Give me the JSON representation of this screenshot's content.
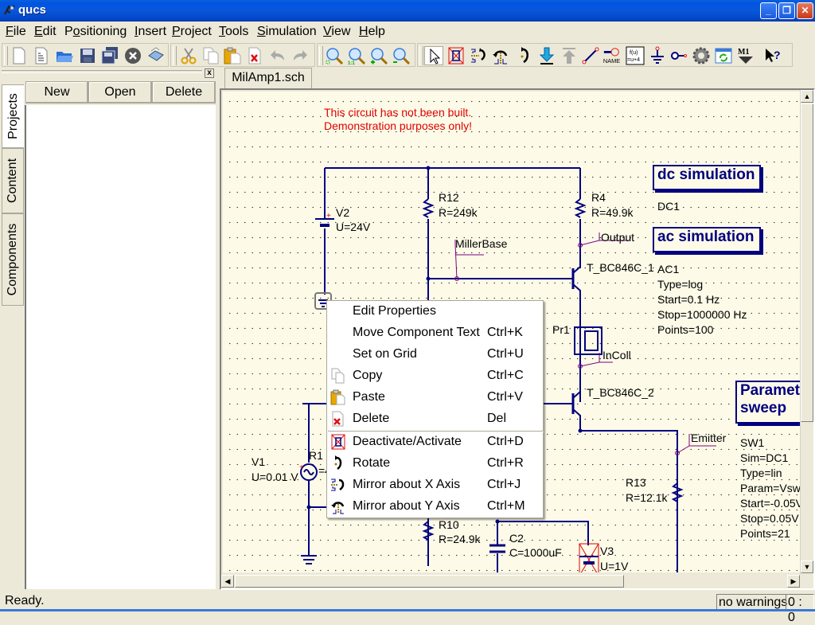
{
  "window": {
    "title": "qucs",
    "minimize": "_",
    "restore": "❐",
    "close": "✕"
  },
  "menubar": [
    {
      "label": "File",
      "accel": "F",
      "rest": "ile"
    },
    {
      "label": "Edit",
      "accel": "E",
      "rest": "dit"
    },
    {
      "label": "Positioning",
      "pre": "P",
      "accel": "o",
      "rest": "sitioning"
    },
    {
      "label": "Insert",
      "accel": "I",
      "rest": "nsert"
    },
    {
      "label": "Project",
      "accel": "P",
      "rest": "roject"
    },
    {
      "label": "Tools",
      "accel": "T",
      "rest": "ools"
    },
    {
      "label": "Simulation",
      "accel": "S",
      "rest": "imulation"
    },
    {
      "label": "View",
      "accel": "V",
      "rest": "iew"
    },
    {
      "label": "Help",
      "accel": "H",
      "rest": "elp"
    }
  ],
  "toolbar": {
    "file_icons": [
      "new-document",
      "new-text",
      "open-folder",
      "save",
      "save-all",
      "close-document",
      "print"
    ],
    "edit_icons": [
      "cut",
      "copy",
      "paste",
      "delete",
      "undo",
      "redo"
    ],
    "view_icons": [
      "zoom-fit",
      "zoom-1to1",
      "zoom-in",
      "zoom-out"
    ],
    "work_icons": [
      "select",
      "deactivate",
      "mirror-x",
      "mirror-y",
      "rotate",
      "go-into-subcircuit",
      "pop-out",
      "wire",
      "wire-label",
      "equation",
      "ground",
      "port",
      "simulate",
      "data-display",
      "marker",
      "whats-this"
    ],
    "wire_label_text": "NAME",
    "equation_text": "f(u)=u+4",
    "marker_text": "M1"
  },
  "left_dock": {
    "tabs": [
      {
        "label": "Projects",
        "active": true
      },
      {
        "label": "Content",
        "active": false
      },
      {
        "label": "Components",
        "active": false
      }
    ],
    "buttons": {
      "new": "New",
      "open": "Open",
      "delete": "Delete"
    },
    "close": "x"
  },
  "document": {
    "tab_label": "MilAmp1.sch",
    "note_line1": "This circuit has not been built.",
    "note_line2": "Demonstration purposes only!",
    "components": {
      "V2": {
        "name": "V2",
        "value": "U=24V"
      },
      "R12": {
        "name": "R12",
        "value": "R=249k"
      },
      "R4": {
        "name": "R4",
        "value": "R=49.9k"
      },
      "T1": {
        "name": "T_BC846C_1"
      },
      "T2": {
        "name": "T_BC846C_2"
      },
      "Pr1": {
        "name": "Pr1"
      },
      "V1": {
        "name": "V1",
        "value": "U=0.01 V"
      },
      "R1": {
        "name": "R1",
        "value": "=4"
      },
      "R10": {
        "name": "R10",
        "value": "R=24.9k"
      },
      "C2": {
        "name": "C2",
        "value": "C=1000uF"
      },
      "V3": {
        "name": "V3",
        "value": "U=1V"
      },
      "R13": {
        "name": "R13",
        "value": "R=12.1k"
      }
    },
    "labels": {
      "miller_base": "MillerBase",
      "output": "Output",
      "in_coll": "InColl",
      "emitter": "Emitter"
    },
    "dc_sim": {
      "title": "dc simulation",
      "name": "DC1"
    },
    "ac_sim": {
      "title": "ac simulation",
      "name": "AC1",
      "params": [
        "Type=log",
        "Start=0.1 Hz",
        "Stop=1000000 Hz",
        "Points=100"
      ]
    },
    "param_sweep": {
      "title_line1": "Paramet",
      "title_line2": "sweep",
      "name": "SW1",
      "params": [
        "Sim=DC1",
        "Type=lin",
        "Param=Vsw",
        "Start=-0.05V",
        "Stop=0.05V",
        "Points=21"
      ]
    }
  },
  "context_menu": {
    "items": [
      {
        "label": "Edit Properties",
        "shortcut": "",
        "icon": ""
      },
      {
        "label": "Move Component Text",
        "shortcut": "Ctrl+K",
        "icon": ""
      },
      {
        "label": "Set on Grid",
        "shortcut": "Ctrl+U",
        "icon": ""
      },
      {
        "label": "Copy",
        "shortcut": "Ctrl+C",
        "icon": "copy"
      },
      {
        "label": "Paste",
        "shortcut": "Ctrl+V",
        "icon": "paste"
      },
      {
        "label": "Delete",
        "shortcut": "Del",
        "icon": "delete"
      },
      {
        "label": "Deactivate/Activate",
        "shortcut": "Ctrl+D",
        "icon": "deactivate"
      },
      {
        "label": "Rotate",
        "shortcut": "Ctrl+R",
        "icon": "rotate"
      },
      {
        "label": "Mirror about X Axis",
        "shortcut": "Ctrl+J",
        "icon": "mirror-x"
      },
      {
        "label": "Mirror about Y Axis",
        "shortcut": "Ctrl+M",
        "icon": "mirror-y"
      }
    ]
  },
  "statusbar": {
    "text": "Ready.",
    "warnings": "no warnings",
    "position": "0 : 0"
  },
  "colors": {
    "wire": "#000080",
    "label_line": "#800080",
    "note": "#e00000",
    "canvas_bg": "#fdfbe8",
    "title_blue": "#0054e3"
  }
}
